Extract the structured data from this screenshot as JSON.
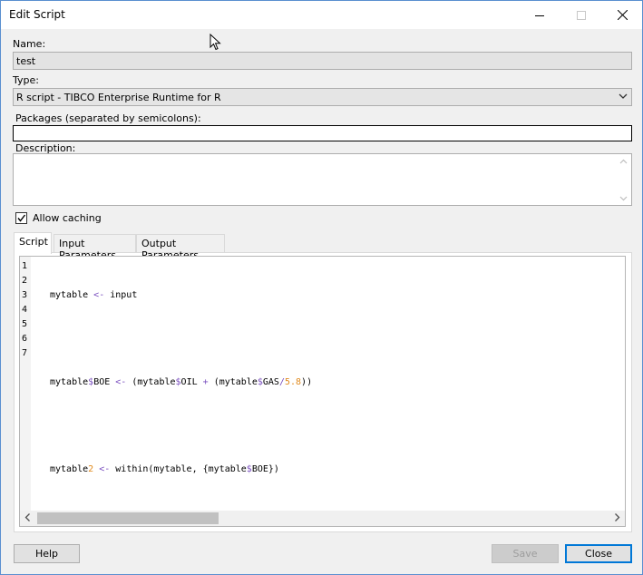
{
  "window": {
    "title": "Edit Script",
    "controls": {
      "minimize": "minimize-icon",
      "maximize": "maximize-icon",
      "close": "close-icon"
    }
  },
  "form": {
    "name_label": "Name:",
    "name_value": "test",
    "type_label": "Type:",
    "type_value": "R script - TIBCO Enterprise Runtime for R",
    "packages_label": "Packages (separated by semicolons):",
    "packages_value": "",
    "description_label": "Description:",
    "description_value": "",
    "allow_caching_label": "Allow caching",
    "allow_caching_checked": true
  },
  "tabs": [
    {
      "label": "Script",
      "active": true
    },
    {
      "label": "Input Parameters",
      "active": false
    },
    {
      "label": "Output Parameters",
      "active": false
    }
  ],
  "editor": {
    "line_numbers": [
      "1",
      "2",
      "3",
      "4",
      "5",
      "6",
      "7"
    ],
    "lines": [
      "mytable <- input",
      "",
      "mytable$BOE <- (mytable$OIL + (mytable$GAS/5.8))",
      "",
      "mytable2 <- within(mytable, {mytable$BOE})",
      "",
      ""
    ]
  },
  "buttons": {
    "help": "Help",
    "save": "Save",
    "close": "Close"
  },
  "colors": {
    "accent": "#0078d7",
    "operator": "#7a4fbf",
    "number": "#e08a1e"
  }
}
